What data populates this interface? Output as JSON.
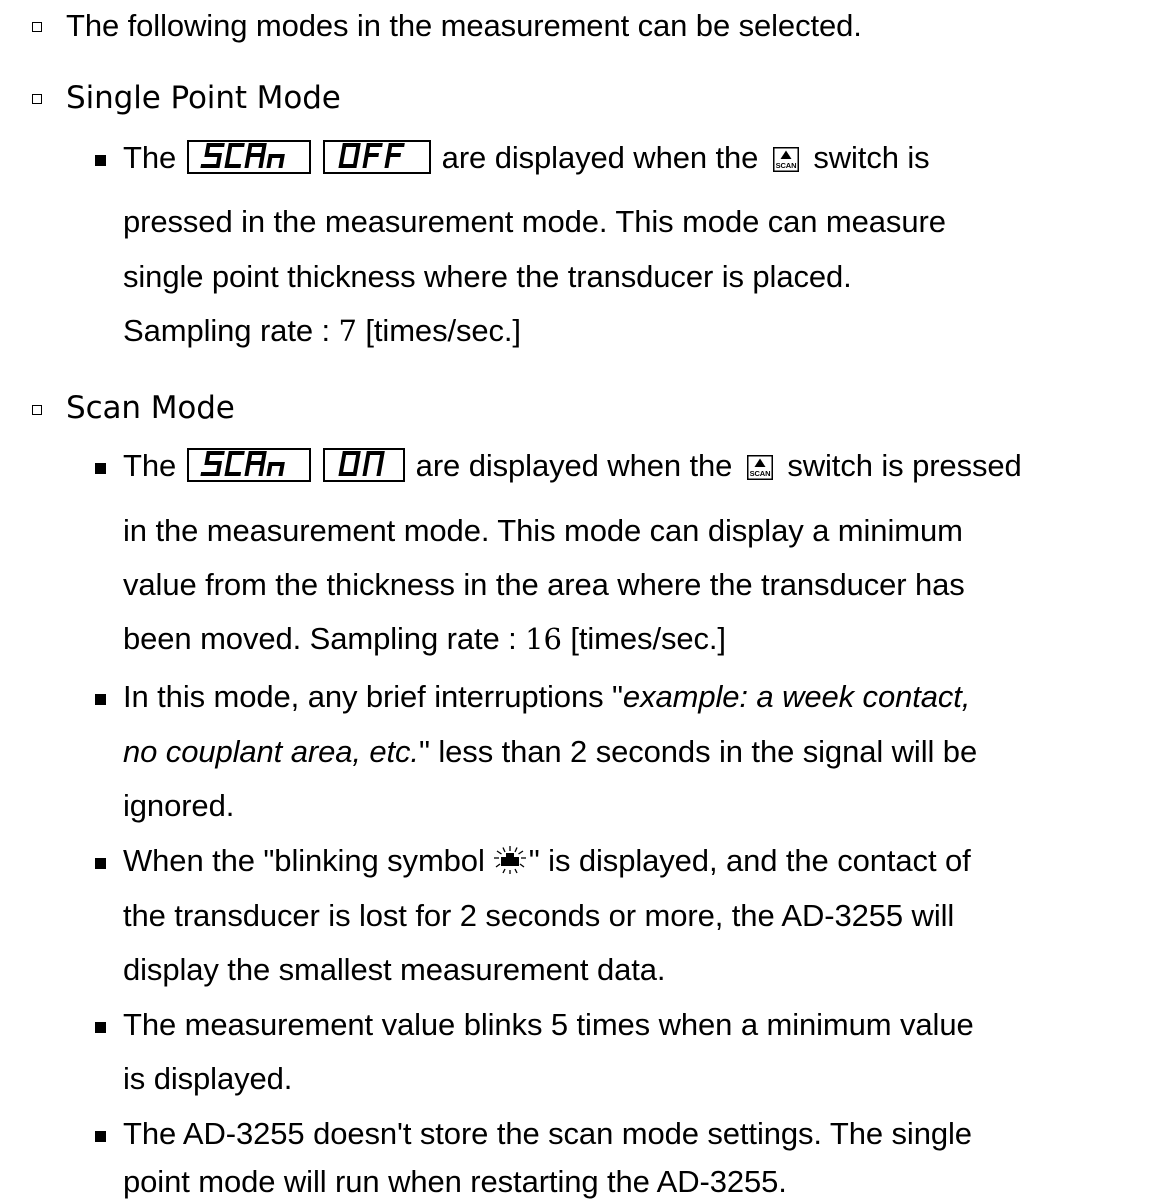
{
  "intro": "The following modes in the measurement can be selected.",
  "single": {
    "heading": "Single Point Mode",
    "the": "The",
    "display_1": "SCAn",
    "display_2": "OFF",
    "after_display": "are displayed when the",
    "scan_icon_label": "SCAN",
    "after_icon": "switch is",
    "line2": "pressed in the measurement mode. This mode can measure",
    "line3": "single point thickness where the transducer is placed.",
    "rate_prefix": "Sampling rate : ",
    "rate_value": "7",
    "rate_suffix": " [times/sec.]"
  },
  "scan": {
    "heading": "Scan Mode",
    "the": "The",
    "display_1": "SCAn",
    "display_2": "On",
    "after_display": "are displayed when the",
    "scan_icon_label": "SCAN",
    "after_icon": "switch is pressed",
    "line2": "in the measurement mode. This mode can display a minimum",
    "line3": "value from the thickness in the area where the transducer has",
    "rate_prefix": "been moved. Sampling rate : ",
    "rate_value": "16",
    "rate_suffix": " [times/sec.]",
    "bullet2_l1_a": "In this mode, any brief interruptions \"",
    "bullet2_l1_em": "example: a week contact,",
    "bullet2_l2_em": "no couplant area, etc.",
    "bullet2_l2_b": "\" less than 2 seconds in the signal will be",
    "bullet2_l3": "ignored.",
    "bullet3_l1_a": "When the \"blinking symbol",
    "bullet3_l1_b": "\" is displayed, and the contact of",
    "bullet3_l2": "the transducer is lost for 2 seconds or more, the AD-3255 will",
    "bullet3_l3": "display the smallest measurement data.",
    "bullet4_l1": "The measurement value blinks 5 times when a minimum value",
    "bullet4_l2": "is displayed.",
    "bullet5_l1": "The AD-3255 doesn't store the scan mode settings. The single",
    "bullet5_l2": "point mode will run when restarting the AD-3255."
  },
  "icons": {
    "hollow_bullet": "hollow-square-bullet",
    "solid_bullet": "solid-square-bullet",
    "scan_switch": "scan-switch-icon",
    "blinking_symbol": "blinking-transducer-icon"
  }
}
